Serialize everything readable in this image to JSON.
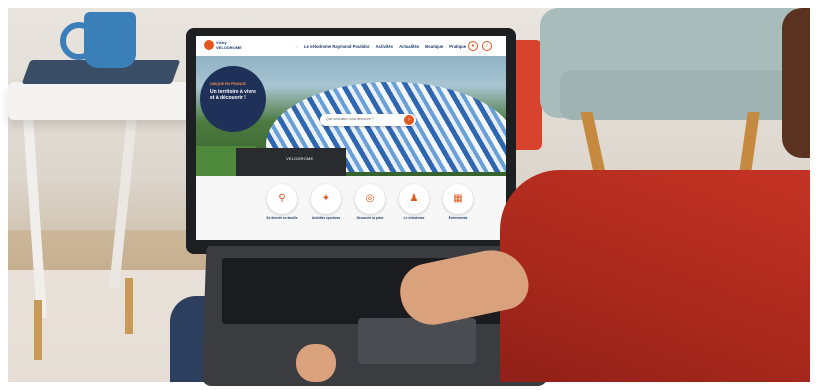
{
  "scene": {
    "description_visible": "Person using a laptop showing a tourism website",
    "colors": {
      "accent": "#e3571e",
      "navy": "#1f3c6b",
      "sweater": "#c43324",
      "chair": "#a9bcbc"
    }
  },
  "website": {
    "logo": {
      "line1": "Vichy",
      "line2": "VELODROME"
    },
    "nav": [
      "Le vélodrome Raymond Poulidor",
      "Activités",
      "Actualités",
      "Boutique",
      "Pratique"
    ],
    "header_icons": [
      "user-icon",
      "search-icon"
    ],
    "hero": {
      "kicker": "UNIQUE EN FRANCE",
      "title": "Un territoire à vivre et à découvrir !",
      "search_placeholder": "Que souhaitez-vous découvrir ?",
      "sign": "VELODROME"
    },
    "categories": [
      {
        "label": "Se divertir en famille",
        "icon": "bike-icon"
      },
      {
        "label": "Activités sportives",
        "icon": "runner-icon"
      },
      {
        "label": "Découvrir la piste",
        "icon": "track-icon"
      },
      {
        "label": "Le vélodrome",
        "icon": "helmet-icon"
      },
      {
        "label": "Événements",
        "icon": "calendar-icon"
      }
    ]
  }
}
